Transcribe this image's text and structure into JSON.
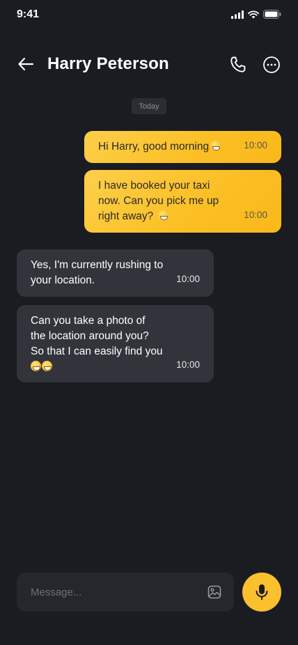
{
  "status_bar": {
    "time": "9:41",
    "icons": [
      "signal-icon",
      "wifi-icon",
      "battery-icon"
    ]
  },
  "header": {
    "contact_name": "Harry Peterson",
    "icons": [
      "arrow-left-icon",
      "phone-icon",
      "more-icon"
    ]
  },
  "date_separator": "Today",
  "messages": [
    {
      "direction": "sent",
      "text": "Hi Harry, good morning",
      "emoji": "grinning-face",
      "time": "10:00"
    },
    {
      "direction": "sent",
      "text": "I have booked your taxi\nnow. Can you pick me up\nright away?",
      "emoji": "grinning-face",
      "time": "10:00"
    },
    {
      "direction": "received",
      "text": "Yes, I'm currently rushing to\nyour location.",
      "time": "10:00"
    },
    {
      "direction": "received",
      "text": "Can you take a photo of\nthe location around you?\nSo that I can easily find you",
      "emoji": "grinning-face x2",
      "time": "10:00"
    }
  ],
  "composer": {
    "placeholder": "Message...",
    "icons": [
      "image-icon",
      "microphone-icon"
    ]
  },
  "colors": {
    "background": "#1b1c21",
    "sent_bubble": "#fbc02d",
    "received_bubble": "#33343b",
    "accent": "#fbc02d"
  }
}
